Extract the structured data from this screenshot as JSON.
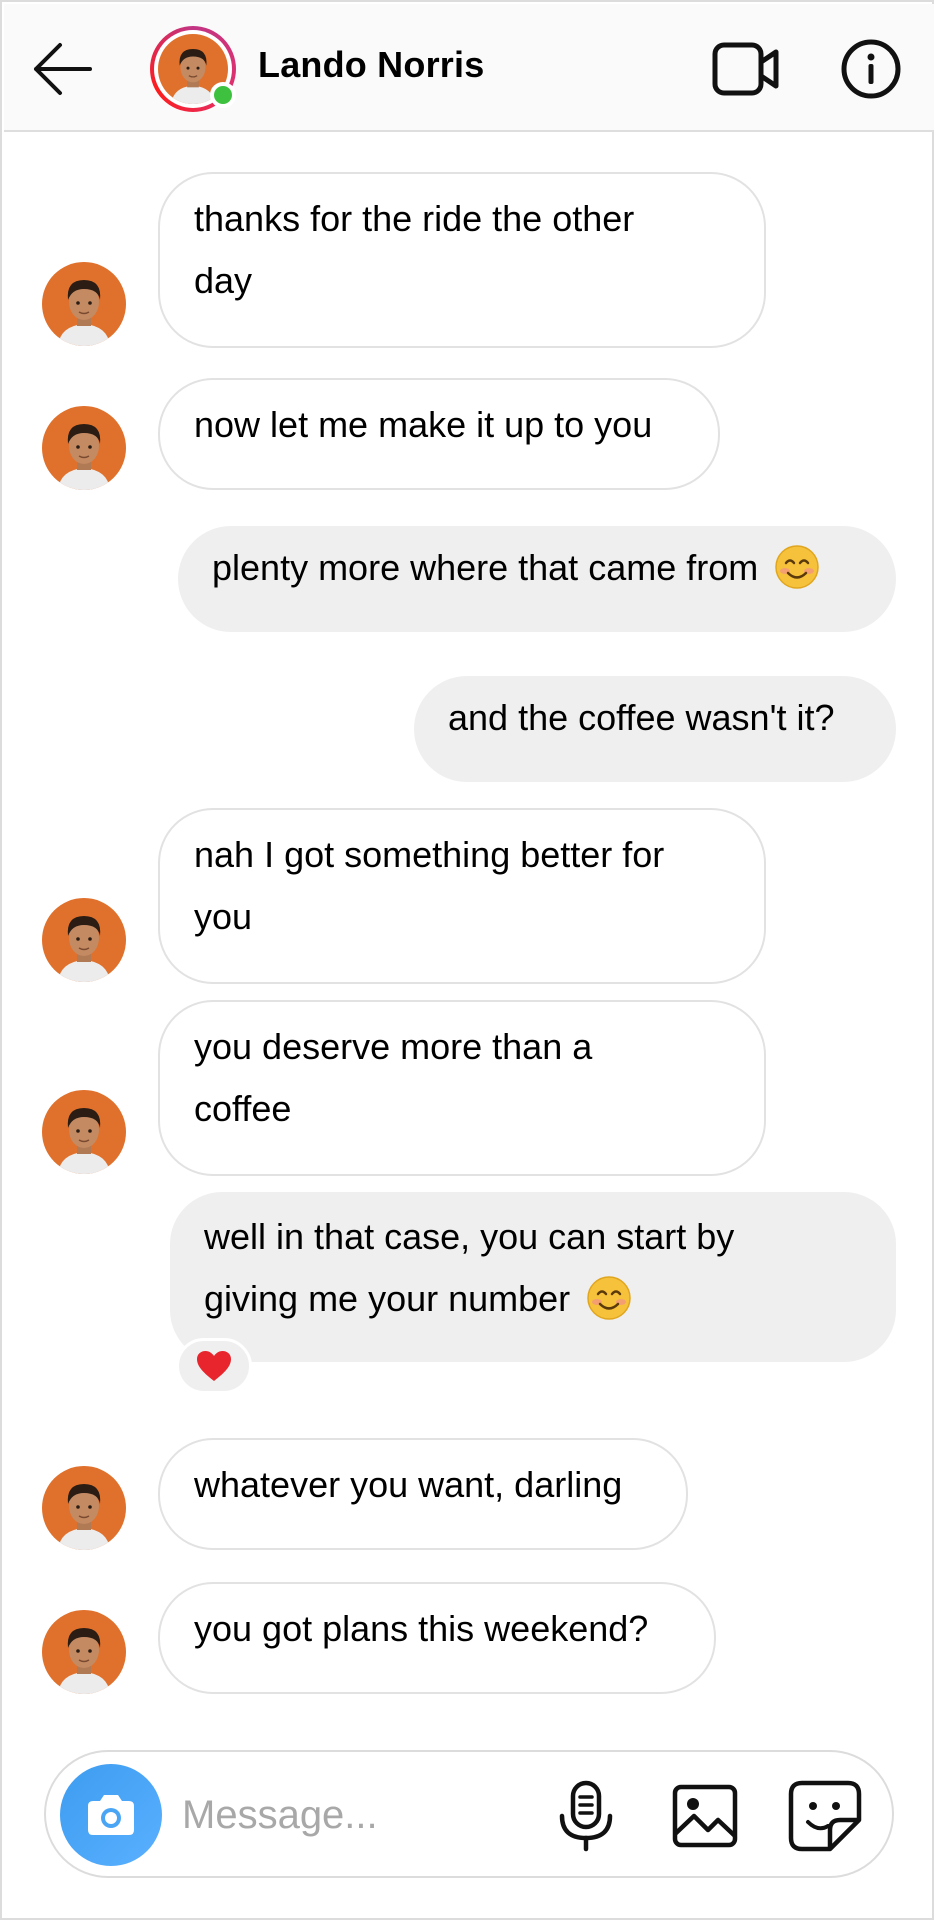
{
  "header": {
    "contact_name": "Lando Norris",
    "online": true
  },
  "messages": [
    {
      "direction": "in",
      "lines": [
        "thanks for the ride the other",
        "day"
      ]
    },
    {
      "direction": "in",
      "lines": [
        "now let me make it up to you"
      ]
    },
    {
      "direction": "out",
      "lines": [
        "plenty more where that came from"
      ],
      "emoji": "smiling-face-emoji"
    },
    {
      "direction": "out",
      "lines": [
        "and the coffee wasn't it?"
      ]
    },
    {
      "direction": "in",
      "lines": [
        "nah I got something better for",
        "you"
      ]
    },
    {
      "direction": "in",
      "lines": [
        "you deserve more than a",
        "coffee"
      ]
    },
    {
      "direction": "out",
      "lines": [
        "well in that case, you can start by",
        "giving me your number"
      ],
      "emoji": "smiling-face-emoji",
      "reaction": "red-heart"
    },
    {
      "direction": "in",
      "lines": [
        "whatever you want, darling"
      ]
    },
    {
      "direction": "in",
      "lines": [
        "you got plans this weekend?"
      ]
    }
  ],
  "composer": {
    "placeholder": "Message..."
  },
  "icons": {
    "back": "arrow-left-icon",
    "video": "video-camera-icon",
    "info": "info-icon",
    "camera": "camera-icon",
    "mic": "microphone-icon",
    "image": "image-icon",
    "sticker": "sticker-icon"
  },
  "colors": {
    "avatar_bg": "#e0712c",
    "online_dot": "#3ec13e",
    "camera_button": "#3d9cf0",
    "outgoing_bubble": "#efefef",
    "reaction_heart": "#e8242c"
  }
}
